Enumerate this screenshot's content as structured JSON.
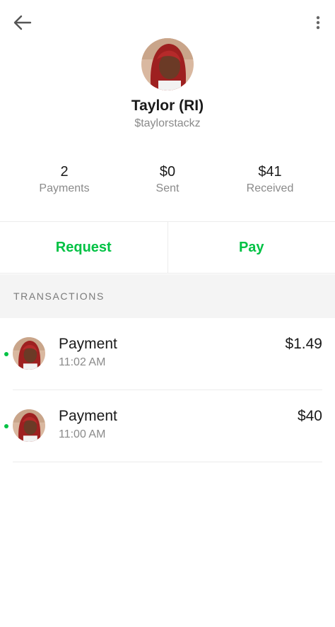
{
  "header": {
    "back_icon": "arrow-left-icon",
    "more_icon": "vertical-ellipsis-icon"
  },
  "profile": {
    "name": "Taylor (RI)",
    "handle": "$taylorstackz"
  },
  "stats": [
    {
      "value": "2",
      "label": "Payments"
    },
    {
      "value": "$0",
      "label": "Sent"
    },
    {
      "value": "$41",
      "label": "Received"
    }
  ],
  "actions": {
    "request_label": "Request",
    "pay_label": "Pay",
    "accent_color": "#00c244"
  },
  "transactions": {
    "header": "TRANSACTIONS",
    "items": [
      {
        "title": "Payment",
        "time": "11:02 AM",
        "amount": "$1.49"
      },
      {
        "title": "Payment",
        "time": "11:00 AM",
        "amount": "$40"
      }
    ]
  }
}
